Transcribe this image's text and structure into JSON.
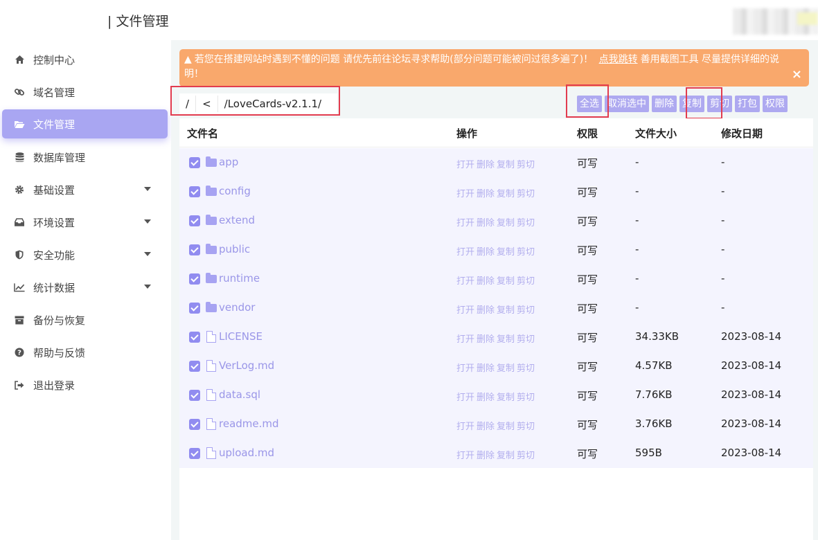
{
  "header": {
    "title": "| 文件管理"
  },
  "sidebar": {
    "items": [
      {
        "label": "控制中心",
        "icon": "home-icon"
      },
      {
        "label": "域名管理",
        "icon": "link-icon"
      },
      {
        "label": "文件管理",
        "icon": "folder-open-icon",
        "active": true
      },
      {
        "label": "数据库管理",
        "icon": "database-icon"
      },
      {
        "label": "基础设置",
        "icon": "gear-icon",
        "expandable": true
      },
      {
        "label": "环境设置",
        "icon": "inbox-icon",
        "expandable": true
      },
      {
        "label": "安全功能",
        "icon": "shield-icon",
        "expandable": true
      },
      {
        "label": "统计数据",
        "icon": "line-chart-icon",
        "expandable": true
      },
      {
        "label": "备份与恢复",
        "icon": "archive-icon"
      },
      {
        "label": "帮助与反馈",
        "icon": "question-icon"
      },
      {
        "label": "退出登录",
        "icon": "sign-out-icon"
      }
    ]
  },
  "alert": {
    "text_before": "若您在搭建网站时遇到不懂的问题 请优先前往论坛寻求帮助(部分问题可能被问过很多遍了)！",
    "link": "点我跳转",
    "text_after": "善用截图工具 尽量提供详细的说明！",
    "close": "×",
    "color": "#f9a86c"
  },
  "path": {
    "root": "/",
    "back": "<",
    "current": "/LoveCards-v2.1.1/"
  },
  "toolbar": {
    "select_all": "全选",
    "deselect": "取消选中",
    "delete": "删除",
    "copy": "复制",
    "cut": "剪切",
    "pack": "打包",
    "permission": "权限"
  },
  "table": {
    "headers": {
      "name": "文件名",
      "actions": "操作",
      "permission": "权限",
      "size": "文件大小",
      "modified": "修改日期"
    },
    "action_labels": [
      "打开",
      "删除",
      "复制",
      "剪切"
    ],
    "rows": [
      {
        "name": "app",
        "type": "folder",
        "perm": "可写",
        "size": "-",
        "date": "-"
      },
      {
        "name": "config",
        "type": "folder",
        "perm": "可写",
        "size": "-",
        "date": "-"
      },
      {
        "name": "extend",
        "type": "folder",
        "perm": "可写",
        "size": "-",
        "date": "-"
      },
      {
        "name": "public",
        "type": "folder",
        "perm": "可写",
        "size": "-",
        "date": "-"
      },
      {
        "name": "runtime",
        "type": "folder",
        "perm": "可写",
        "size": "-",
        "date": "-"
      },
      {
        "name": "vendor",
        "type": "folder",
        "perm": "可写",
        "size": "-",
        "date": "-"
      },
      {
        "name": "LICENSE",
        "type": "file",
        "perm": "可写",
        "size": "34.33KB",
        "date": "2023-08-14"
      },
      {
        "name": "VerLog.md",
        "type": "file",
        "perm": "可写",
        "size": "4.57KB",
        "date": "2023-08-14"
      },
      {
        "name": "data.sql",
        "type": "file",
        "perm": "可写",
        "size": "7.76KB",
        "date": "2023-08-14"
      },
      {
        "name": "readme.md",
        "type": "file",
        "perm": "可写",
        "size": "3.76KB",
        "date": "2023-08-14"
      },
      {
        "name": "upload.md",
        "type": "file",
        "perm": "可写",
        "size": "595B",
        "date": "2023-08-14"
      }
    ]
  },
  "colors": {
    "accent": "#a9a6f2",
    "checkbox": "#918cf0",
    "highlight_box": "#e23b4e"
  }
}
